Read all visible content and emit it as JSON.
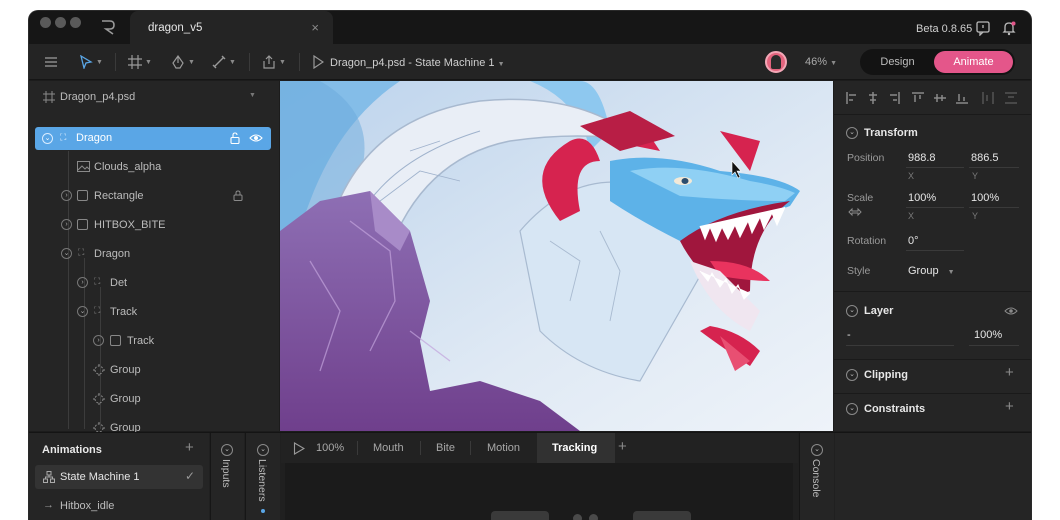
{
  "app": {
    "tab_title": "dragon_v5",
    "tab_close": "×",
    "version": "Beta 0.8.65"
  },
  "toolbar": {
    "state_machine_label": "Dragon_p4.psd - State Machine 1",
    "zoom": "46%",
    "mode_design": "Design",
    "mode_animate": "Animate"
  },
  "hierarchy": {
    "file_name": "Dragon_p4.psd",
    "items": [
      {
        "label": "Dragon",
        "selected": true
      },
      {
        "label": "Clouds_alpha"
      },
      {
        "label": "Rectangle"
      },
      {
        "label": "HITBOX_BITE"
      },
      {
        "label": "Dragon"
      },
      {
        "label": "Det"
      },
      {
        "label": "Track"
      },
      {
        "label": "Track"
      },
      {
        "label": "Group"
      },
      {
        "label": "Group"
      },
      {
        "label": "Group"
      }
    ]
  },
  "inspector": {
    "transform_title": "Transform",
    "position_label": "Position",
    "position_x": "988.8",
    "position_y": "886.5",
    "scale_label": "Scale",
    "scale_x": "100%",
    "scale_y": "100%",
    "x_sub": "X",
    "y_sub": "Y",
    "rotation_label": "Rotation",
    "rotation_value": "0°",
    "style_label": "Style",
    "style_value": "Group",
    "layer_title": "Layer",
    "layer_blend": "-",
    "layer_opacity": "100%",
    "clipping_title": "Clipping",
    "constraints_title": "Constraints"
  },
  "bottom": {
    "animations_title": "Animations",
    "add": "+",
    "state_machine": "State Machine 1",
    "animation_item": "Hitbox_idle",
    "inputs_label": "Inputs",
    "listeners_label": "Listeners",
    "console_label": "Console",
    "play_zoom": "100%",
    "tabs": [
      "Mouth",
      "Bite",
      "Motion",
      "Tracking"
    ],
    "active_tab": "Tracking"
  },
  "colors": {
    "accent_pink": "#e4568a",
    "selection_blue": "#5aa6e6",
    "panel": "#252525"
  }
}
